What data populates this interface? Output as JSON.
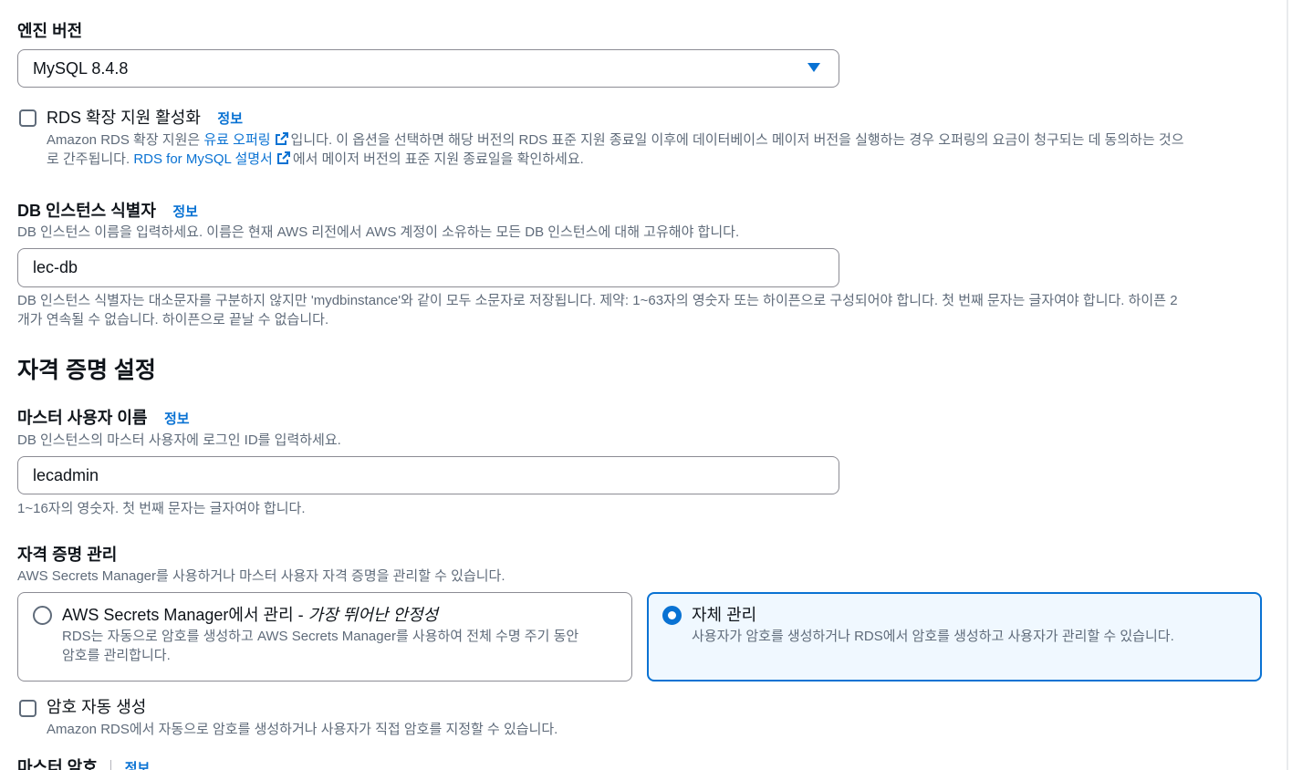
{
  "engine_version": {
    "label": "엔진 버전",
    "selected": "MySQL 8.4.8"
  },
  "extended_support": {
    "label": "RDS 확장 지원 활성화",
    "info": "정보",
    "desc_part1": "Amazon RDS 확장 지원은 ",
    "link1": "유료 오퍼링",
    "desc_part2": "입니다. 이 옵션을 선택하면 해당 버전의 RDS 표준 지원 종료일 이후에 데이터베이스 메이저 버전을 실행하는 경우 오퍼링의 요금이 청구되는 데 동의하는 것으",
    "desc_part3": "로 간주됩니다. ",
    "link2": "RDS for MySQL 설명서",
    "desc_part4": "에서 메이저 버전의 표준 지원 종료일을 확인하세요."
  },
  "db_identifier": {
    "label": "DB 인스턴스 식별자",
    "info": "정보",
    "desc": "DB 인스턴스 이름을 입력하세요. 이름은 현재 AWS 리전에서 AWS 계정이 소유하는 모든 DB 인스턴스에 대해 고유해야 합니다.",
    "value": "lec-db",
    "hint_line1": "DB 인스턴스 식별자는 대소문자를 구분하지 않지만 'mydbinstance'와 같이 모두 소문자로 저장됩니다. 제약: 1~63자의 영숫자 또는 하이픈으로 구성되어야 합니다. 첫 번째 문자는 글자여야 합니다. 하이픈 2",
    "hint_line2": "개가 연속될 수 없습니다. 하이픈으로 끝날 수 없습니다."
  },
  "credentials_section": {
    "title": "자격 증명 설정"
  },
  "master_username": {
    "label": "마스터 사용자 이름",
    "info": "정보",
    "desc": "DB 인스턴스의 마스터 사용자에 로그인 ID를 입력하세요.",
    "value": "lecadmin",
    "hint": "1~16자의 영숫자. 첫 번째 문자는 글자여야 합니다."
  },
  "credential_management": {
    "label": "자격 증명 관리",
    "desc": "AWS Secrets Manager를 사용하거나 마스터 사용자 자격 증명을 관리할 수 있습니다.",
    "options": [
      {
        "title": "AWS Secrets Manager에서 관리 - ",
        "title_italic": "가장 뛰어난 안정성",
        "desc_line1": "RDS는 자동으로 암호를 생성하고 AWS Secrets Manager를 사용하여 전체 수명 주기 동안",
        "desc_line2": "암호를 관리합니다.",
        "selected": false
      },
      {
        "title": "자체 관리",
        "desc_line1": "사용자가 암호를 생성하거나 RDS에서 암호를 생성하고 사용자가 관리할 수 있습니다.",
        "selected": true
      }
    ]
  },
  "auto_password": {
    "label": "암호 자동 생성",
    "desc": "Amazon RDS에서 자동으로 암호를 생성하거나 사용자가 직접 암호를 지정할 수 있습니다."
  },
  "master_password": {
    "label": "마스터 암호",
    "info": "정보"
  },
  "colors": {
    "accent": "#0972d3",
    "text": "#0f141a",
    "muted": "#5f6b7a"
  }
}
